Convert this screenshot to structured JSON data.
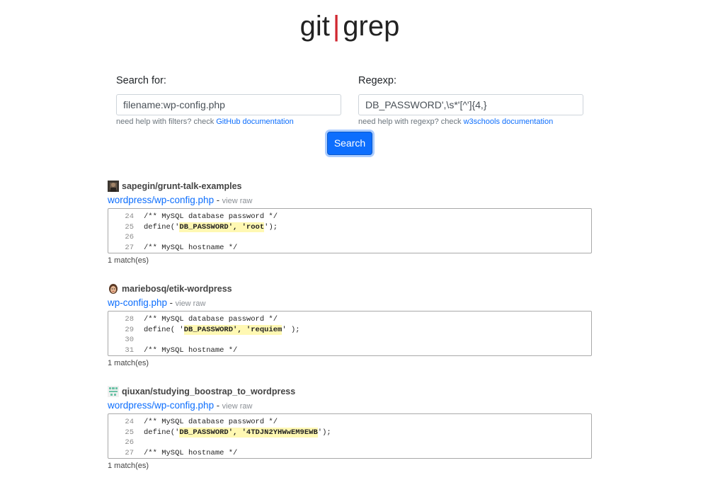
{
  "header": {
    "title_left": "git",
    "title_sep": "|",
    "title_right": "grep"
  },
  "search": {
    "label": "Search for:",
    "value": "filename:wp-config.php",
    "help_text": "need help with filters? check ",
    "help_link": "GitHub documentation"
  },
  "regexp": {
    "label": "Regexp:",
    "value": "DB_PASSWORD',\\s*'[^']{4,}",
    "help_text": "need help with regexp? check ",
    "help_link": "w3schools documentation"
  },
  "search_button": "Search",
  "results": [
    {
      "repo": "sapegin/grunt-talk-examples",
      "file": "wordpress/wp-config.php",
      "sep": " - ",
      "view_raw": "view raw",
      "lines": [
        {
          "num": "24",
          "pre": "/** MySQL database password */",
          "hl": "",
          "post": ""
        },
        {
          "num": "25",
          "pre": "define('",
          "hl": "DB_PASSWORD', 'root",
          "post": "');"
        },
        {
          "num": "26",
          "pre": "",
          "hl": "",
          "post": ""
        },
        {
          "num": "27",
          "pre": "/** MySQL hostname */",
          "hl": "",
          "post": ""
        }
      ],
      "matches": "1 match(es)"
    },
    {
      "repo": "mariebosq/etik-wordpress",
      "file": "wp-config.php",
      "sep": " - ",
      "view_raw": "view raw",
      "lines": [
        {
          "num": "28",
          "pre": "/** MySQL database password */",
          "hl": "",
          "post": ""
        },
        {
          "num": "29",
          "pre": "define( '",
          "hl": "DB_PASSWORD', 'requiem",
          "post": "' );"
        },
        {
          "num": "30",
          "pre": "",
          "hl": "",
          "post": ""
        },
        {
          "num": "31",
          "pre": "/** MySQL hostname */",
          "hl": "",
          "post": ""
        }
      ],
      "matches": "1 match(es)"
    },
    {
      "repo": "qiuxan/studying_boostrap_to_wordpress",
      "file": "wordpress/wp-config.php",
      "sep": " - ",
      "view_raw": "view raw",
      "lines": [
        {
          "num": "24",
          "pre": "/** MySQL database password */",
          "hl": "",
          "post": ""
        },
        {
          "num": "25",
          "pre": "define('",
          "hl": "DB_PASSWORD', '4TDJN2YHWwEM9EWB",
          "post": "');"
        },
        {
          "num": "26",
          "pre": "",
          "hl": "",
          "post": ""
        },
        {
          "num": "27",
          "pre": "/** MySQL hostname */",
          "hl": "",
          "post": ""
        }
      ],
      "matches": "1 match(es)"
    }
  ]
}
